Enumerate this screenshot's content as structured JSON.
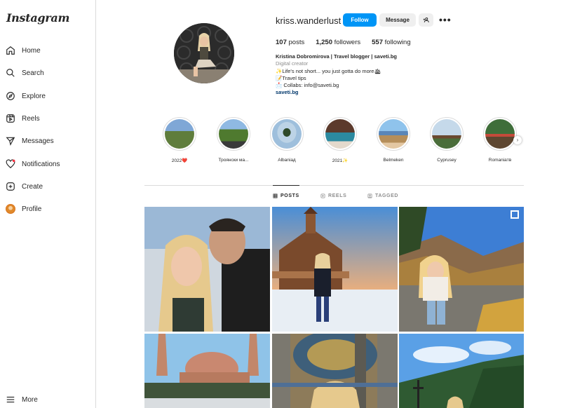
{
  "app": {
    "logo": "Instagram"
  },
  "sidebar": {
    "items": [
      {
        "label": "Home",
        "icon": "home-icon"
      },
      {
        "label": "Search",
        "icon": "search-icon"
      },
      {
        "label": "Explore",
        "icon": "compass-icon"
      },
      {
        "label": "Reels",
        "icon": "reels-icon"
      },
      {
        "label": "Messages",
        "icon": "send-icon"
      },
      {
        "label": "Notifications",
        "icon": "heart-icon"
      },
      {
        "label": "Create",
        "icon": "plus-square-icon"
      },
      {
        "label": "Profile",
        "icon": "avatar"
      }
    ],
    "more_label": "More"
  },
  "profile": {
    "username": "kriss.wanderlust",
    "follow_label": "Follow",
    "message_label": "Message",
    "stats": {
      "posts": "107",
      "posts_label": "posts",
      "followers": "1,250",
      "followers_label": "followers",
      "following": "557",
      "following_label": "following"
    },
    "bio": {
      "name": "Kristina Dobromirova | Travel blogger | saveti.bg",
      "category": "Digital creator",
      "line1": "✨Life's not short... you just gotta do more🛳",
      "line2": "📝Travel tips",
      "line3": "📩 Collabs: info@saveti.bg",
      "link": "saveti.bg"
    }
  },
  "highlights": [
    {
      "label": "2022❤️"
    },
    {
      "label": "Троянски ма..."
    },
    {
      "label": "Albaniaд"
    },
    {
      "label": "2021✨"
    },
    {
      "label": "Belmeken"
    },
    {
      "label": "Cyprusey"
    },
    {
      "label": "Romaniaтв"
    }
  ],
  "tabs": [
    {
      "label": "POSTS",
      "icon": "grid-icon"
    },
    {
      "label": "REELS",
      "icon": "reels-icon"
    },
    {
      "label": "TAGGED",
      "icon": "tag-icon"
    }
  ],
  "colors": {
    "accent": "#0095f6",
    "border": "#dbdbdb",
    "link": "#00376b"
  }
}
